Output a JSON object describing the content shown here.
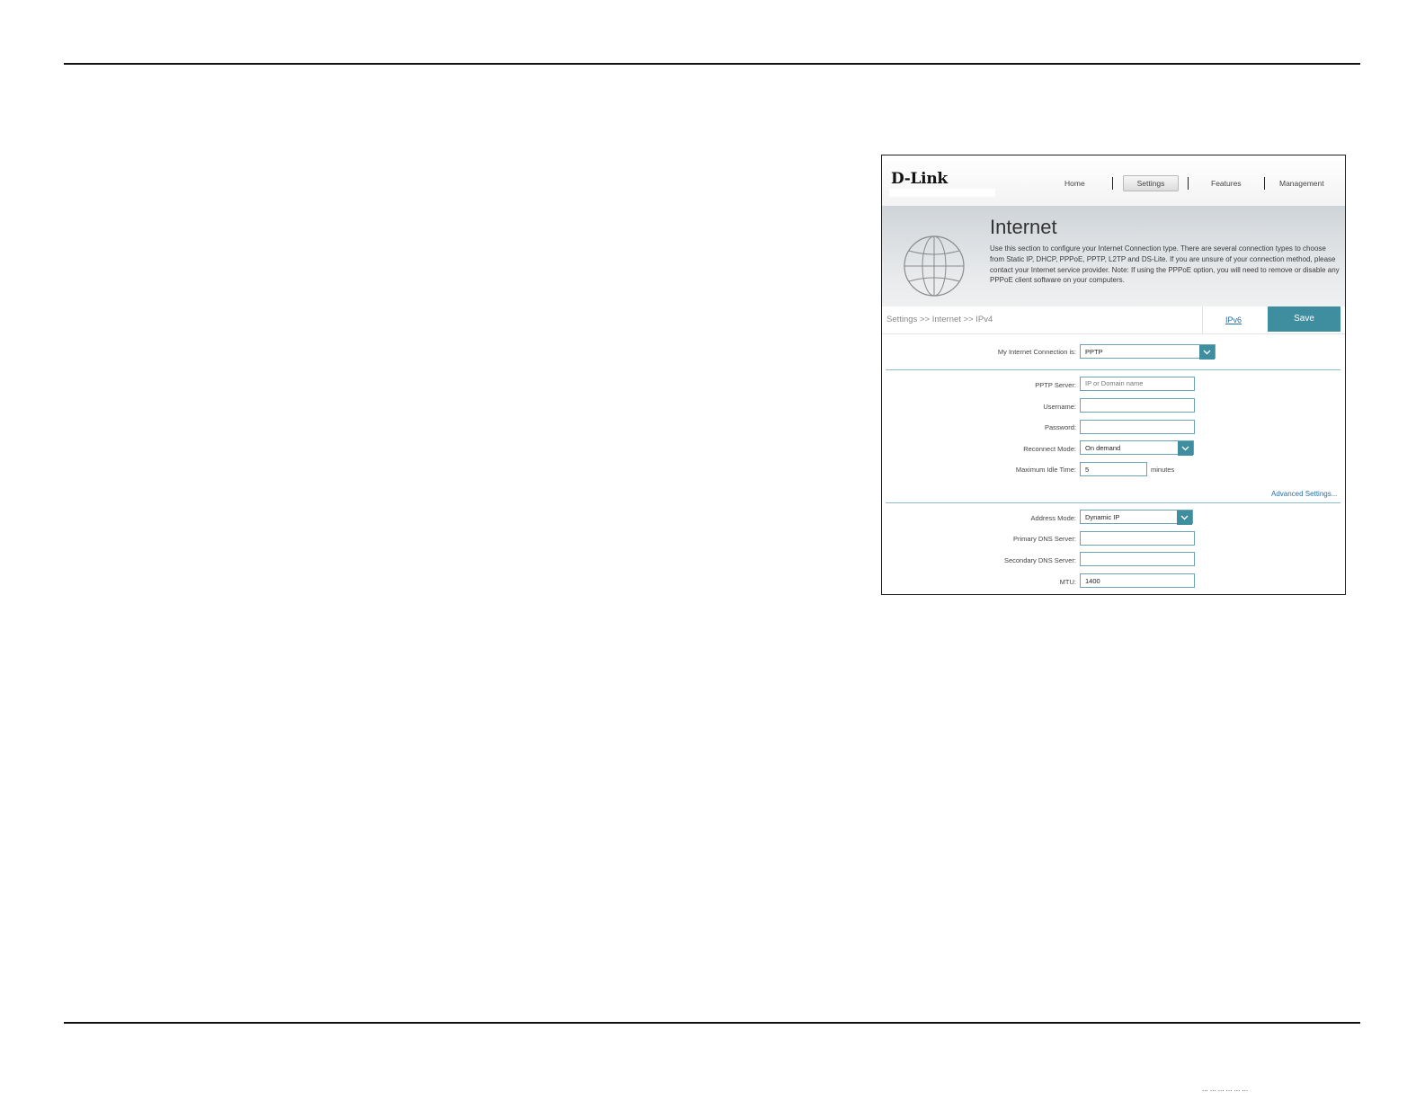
{
  "brand": {
    "logo": "D-Link"
  },
  "nav": {
    "items": [
      {
        "label": "Home"
      },
      {
        "label": "Settings",
        "active": true
      },
      {
        "label": "Features"
      },
      {
        "label": "Management"
      }
    ]
  },
  "banner": {
    "title": "Internet",
    "description": "Use this section to configure your Internet Connection type. There are several connection types to choose from Static IP, DHCP, PPPoE, PPTP, L2TP and DS-Lite. If you are unsure of your connection method, please contact your Internet service provider. Note: If using the PPPoE option, you will need to remove or disable any PPPoE client software on your computers."
  },
  "breadcrumb": "Settings >> Internet >> IPv4",
  "links": {
    "ipv6": "IPv6",
    "advanced": "Advanced Settings..."
  },
  "buttons": {
    "save": "Save"
  },
  "form": {
    "connection": {
      "label": "My Internet Connection is:",
      "value": "PPTP"
    },
    "pptp_server": {
      "label": "PPTP Server:",
      "placeholder": "IP or Domain name"
    },
    "username": {
      "label": "Username:",
      "value": ""
    },
    "password": {
      "label": "Password:",
      "value": ""
    },
    "reconnect_mode": {
      "label": "Reconnect Mode:",
      "value": "On demand"
    },
    "max_idle": {
      "label": "Maximum Idle Time:",
      "value": "5",
      "unit": "minutes"
    },
    "address_mode": {
      "label": "Address Mode:",
      "value": "Dynamic IP"
    },
    "primary_dns": {
      "label": "Primary DNS Server:",
      "value": ""
    },
    "secondary_dns": {
      "label": "Secondary DNS Server:",
      "value": ""
    },
    "mtu": {
      "label": "MTU:",
      "value": "1400"
    }
  },
  "colors": {
    "accent": "#3f8ea0",
    "link": "#2b6ea3",
    "field_border": "#6aa4b4"
  },
  "footer": {
    "text": "... ... ... ... ... ..."
  }
}
